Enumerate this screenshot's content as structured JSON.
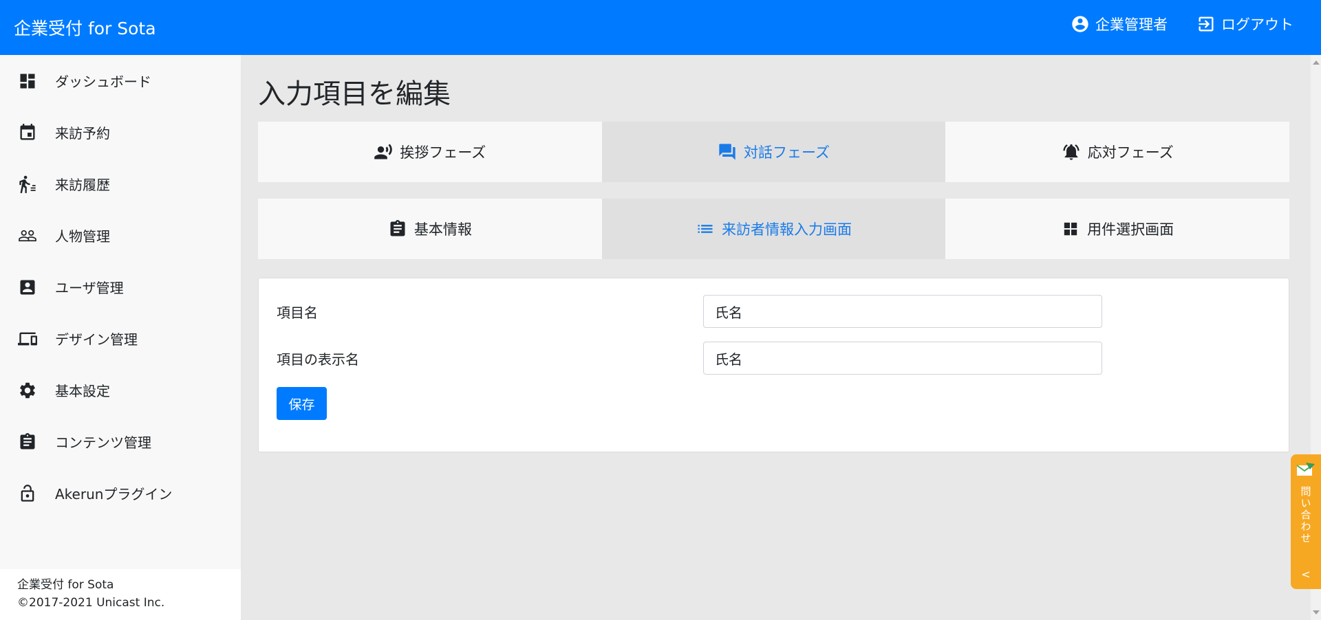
{
  "header": {
    "brand": "企業受付 for Sota",
    "user_label": "企業管理者",
    "logout_label": "ログアウト"
  },
  "sidebar": {
    "items": [
      {
        "label": "ダッシュボード",
        "icon": "dashboard-icon"
      },
      {
        "label": "来訪予約",
        "icon": "calendar-icon"
      },
      {
        "label": "来訪履歴",
        "icon": "walking-person-icon"
      },
      {
        "label": "人物管理",
        "icon": "people-icon"
      },
      {
        "label": "ユーザ管理",
        "icon": "contact-card-icon"
      },
      {
        "label": "デザイン管理",
        "icon": "devices-icon"
      },
      {
        "label": "基本設定",
        "icon": "gear-icon"
      },
      {
        "label": "コンテンツ管理",
        "icon": "clipboard-icon"
      },
      {
        "label": "Akerunプラグイン",
        "icon": "lock-icon"
      }
    ],
    "footer_line1": "企業受付 for Sota",
    "footer_line2": "©2017-2021 Unicast Inc."
  },
  "main": {
    "title": "入力項目を編集",
    "phase_tabs": [
      {
        "label": "挨拶フェーズ",
        "icon": "speaking-person-icon",
        "active": false
      },
      {
        "label": "対話フェーズ",
        "icon": "chat-bubbles-icon",
        "active": true
      },
      {
        "label": "応対フェーズ",
        "icon": "bell-icon",
        "active": false
      }
    ],
    "screen_tabs": [
      {
        "label": "基本情報",
        "icon": "clipboard-icon",
        "active": false
      },
      {
        "label": "来訪者情報入力画面",
        "icon": "list-icon",
        "active": true
      },
      {
        "label": "用件選択画面",
        "icon": "grid-icon",
        "active": false
      }
    ],
    "form": {
      "field1_label": "項目名",
      "field1_value": "氏名",
      "field2_label": "項目の表示名",
      "field2_value": "氏名",
      "save_label": "保存"
    }
  },
  "contact_widget": {
    "label": "問い合わせ",
    "chevron": "<"
  },
  "colors": {
    "primary": "#007bff",
    "active_tab_text": "#1a7be8",
    "contact_widget": "#f7a823"
  }
}
